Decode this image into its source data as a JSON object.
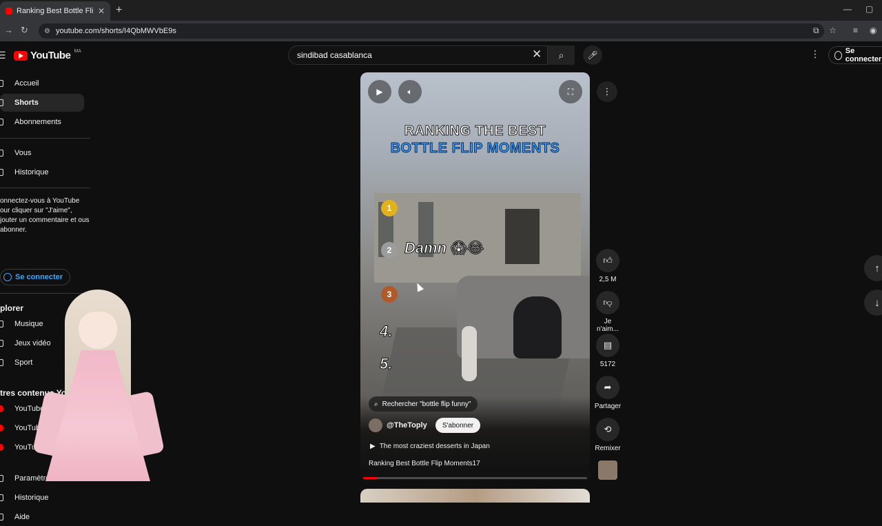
{
  "browser": {
    "tab_title": "Ranking Best Bottle Flip Moments",
    "url": "youtube.com/shorts/I4QbMWVbE9s"
  },
  "header": {
    "logo_text": "YouTube",
    "country_code": "MA",
    "search_value": "sindibad casablanca",
    "signin_label": "Se connecter"
  },
  "sidebar": {
    "items_top": [
      "Accueil",
      "Shorts",
      "Abonnements"
    ],
    "items_you": [
      "Vous",
      "Historique"
    ],
    "signin_prompt": "onnectez-vous à YouTube our cliquer sur \"J'aime\", jouter un commentaire et ous abonner.",
    "signin_button": "Se connecter",
    "explore_heading": "plorer",
    "explore_items": [
      "Musique",
      "Jeux vidéo",
      "Sport"
    ],
    "more_heading": "tres contenus YouTube",
    "more_items": [
      "YouTube Premium",
      "YouTube Music",
      "YouTube Kids"
    ],
    "bottom_items": [
      "Paramètres",
      "Historique",
      "Aide"
    ]
  },
  "short": {
    "title_line1": "RANKING THE BEST",
    "title_line2": "BOTTLE FLIP MOMENTS",
    "caption": "Damn 😱😂",
    "medals": [
      "1",
      "2",
      "3"
    ],
    "ranks": [
      "4.",
      "5."
    ],
    "search_chip": "Rechercher \"bottle flip funny\"",
    "channel": "@TheToply",
    "subscribe_label": "S'abonner",
    "related_video": "The most craziest desserts in Japan",
    "video_title": "Ranking Best Bottle Flip Moments17",
    "progress": 0.06
  },
  "actions": {
    "likes": "2,5 M",
    "dislike_label": "Je n'aim...",
    "comments": "5172",
    "share_label": "Partager",
    "remix_label": "Remixer"
  },
  "icons": {
    "play": "play-icon",
    "volume": "volume-icon",
    "fullscreen": "fullscreen-icon",
    "like": "thumbs-up-icon",
    "dislike": "thumbs-down-icon"
  },
  "colors": {
    "brand_red": "#ff0000",
    "link_blue": "#3ea6ff",
    "title_blue": "#3aa0ff"
  }
}
